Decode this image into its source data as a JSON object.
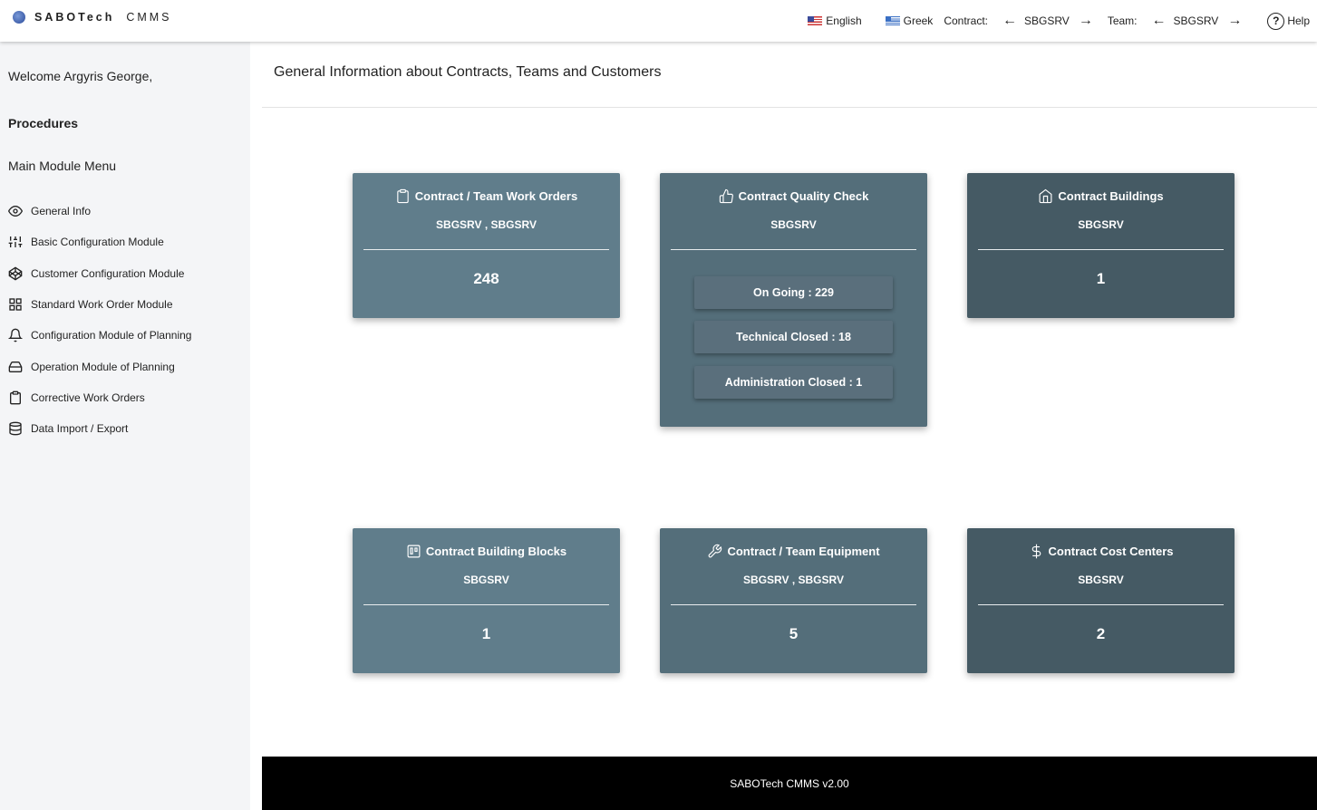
{
  "brand": {
    "name_bold": "SABOTech",
    "name_light": "CMMS"
  },
  "topnav": {
    "lang_english": "English",
    "lang_greek": "Greek",
    "contract_label": "Contract:",
    "contract_value": "SBGSRV",
    "team_label": "Team:",
    "team_value": "SBGSRV",
    "help_label": "Help",
    "arrow_left": "←",
    "arrow_right": "→",
    "help_glyph": "?"
  },
  "sidebar": {
    "welcome": "Welcome Argyris George,",
    "procedures": "Procedures",
    "main_menu": "Main Module Menu",
    "items": [
      {
        "label": "General Info",
        "icon": "eye-icon"
      },
      {
        "label": "Basic Configuration Module",
        "icon": "sliders-icon"
      },
      {
        "label": "Customer Configuration Module",
        "icon": "codepen-icon"
      },
      {
        "label": "Standard Work Order Module",
        "icon": "grid-icon"
      },
      {
        "label": "Configuration Module of Planning",
        "icon": "bell-icon"
      },
      {
        "label": "Operation Module of Planning",
        "icon": "hard-drive-icon"
      },
      {
        "label": "Corrective Work Orders",
        "icon": "clipboard-icon"
      },
      {
        "label": "Data Import / Export",
        "icon": "database-icon"
      }
    ]
  },
  "main": {
    "title": "General Information about Contracts, Teams and Customers",
    "cards": {
      "work_orders": {
        "title": "Contract / Team Work Orders",
        "sub": "SBGSRV , SBGSRV",
        "value": "248",
        "icon": "clipboard-icon",
        "color": "#607d8b"
      },
      "quality": {
        "title": "Contract Quality Check",
        "sub": "SBGSRV",
        "icon": "thumbs-up-icon",
        "color": "#546e7a",
        "buttons": [
          "On Going : 229",
          "Technical Closed : 18",
          "Administration Closed : 1"
        ]
      },
      "buildings": {
        "title": "Contract Buildings",
        "sub": "SBGSRV",
        "value": "1",
        "icon": "home-icon",
        "color": "#455a64"
      },
      "blocks": {
        "title": "Contract Building Blocks",
        "sub": "SBGSRV",
        "value": "1",
        "icon": "trello-icon",
        "color": "#607d8b"
      },
      "equipment": {
        "title": "Contract / Team Equipment",
        "sub": "SBGSRV , SBGSRV",
        "value": "5",
        "icon": "tool-icon",
        "color": "#546e7a"
      },
      "cost_centers": {
        "title": "Contract Cost Centers",
        "sub": "SBGSRV",
        "value": "2",
        "icon": "dollar-sign-icon",
        "color": "#455a64"
      }
    }
  },
  "footer": {
    "text": "SABOTech CMMS v2.00"
  }
}
